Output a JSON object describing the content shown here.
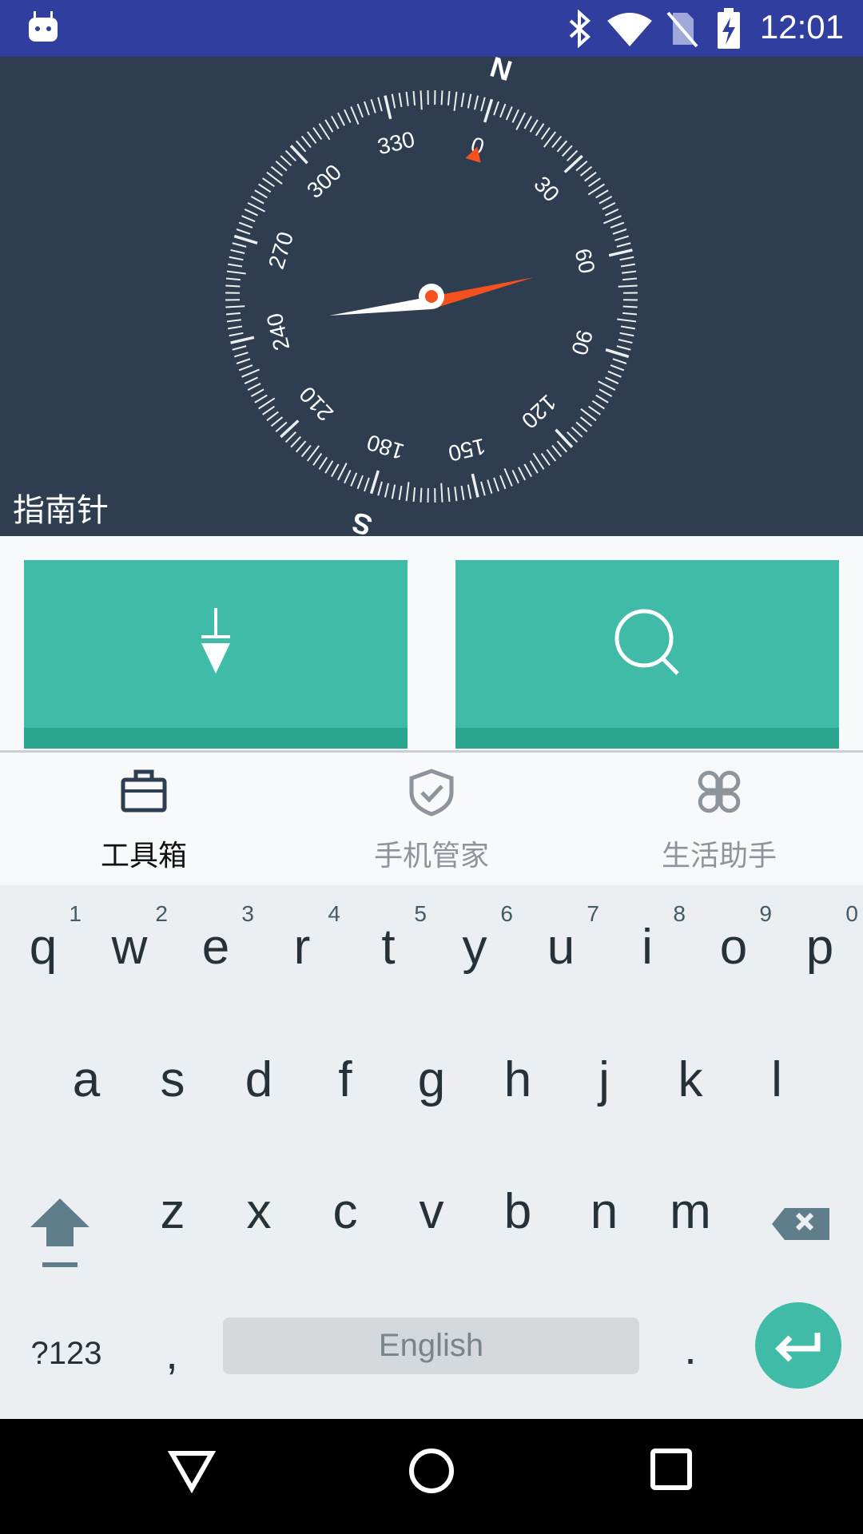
{
  "status_bar": {
    "time": "12:01",
    "icons": [
      "android-notification-icon",
      "bluetooth-icon",
      "wifi-icon",
      "no-sim-icon",
      "battery-charging-icon"
    ]
  },
  "compass": {
    "title": "指南针",
    "degree_labels": [
      "0",
      "30",
      "60",
      "90",
      "120",
      "150",
      "180",
      "210",
      "240",
      "270",
      "300",
      "330"
    ],
    "cardinals": [
      "N",
      "S"
    ],
    "needle_color": "#f4511e"
  },
  "tools": {
    "tiles": [
      {
        "icon": "pendulum-icon"
      },
      {
        "icon": "search-icon"
      }
    ],
    "tile_color": "#3fbba7"
  },
  "bottom_nav": {
    "items": [
      {
        "label": "工具箱",
        "icon": "toolbox-icon",
        "active": true
      },
      {
        "label": "手机管家",
        "icon": "shield-check-icon",
        "active": false
      },
      {
        "label": "生活助手",
        "icon": "grid-flower-icon",
        "active": false
      }
    ]
  },
  "keyboard": {
    "row1": [
      {
        "char": "q",
        "hint": "1"
      },
      {
        "char": "w",
        "hint": "2"
      },
      {
        "char": "e",
        "hint": "3"
      },
      {
        "char": "r",
        "hint": "4"
      },
      {
        "char": "t",
        "hint": "5"
      },
      {
        "char": "y",
        "hint": "6"
      },
      {
        "char": "u",
        "hint": "7"
      },
      {
        "char": "i",
        "hint": "8"
      },
      {
        "char": "o",
        "hint": "9"
      },
      {
        "char": "p",
        "hint": "0"
      }
    ],
    "row2": [
      "a",
      "s",
      "d",
      "f",
      "g",
      "h",
      "j",
      "k",
      "l"
    ],
    "row3": [
      "z",
      "x",
      "c",
      "v",
      "b",
      "n",
      "m"
    ],
    "symbols_label": "?123",
    "comma": ",",
    "space_label": "English",
    "period": ".",
    "accent_color": "#3fbba7"
  }
}
